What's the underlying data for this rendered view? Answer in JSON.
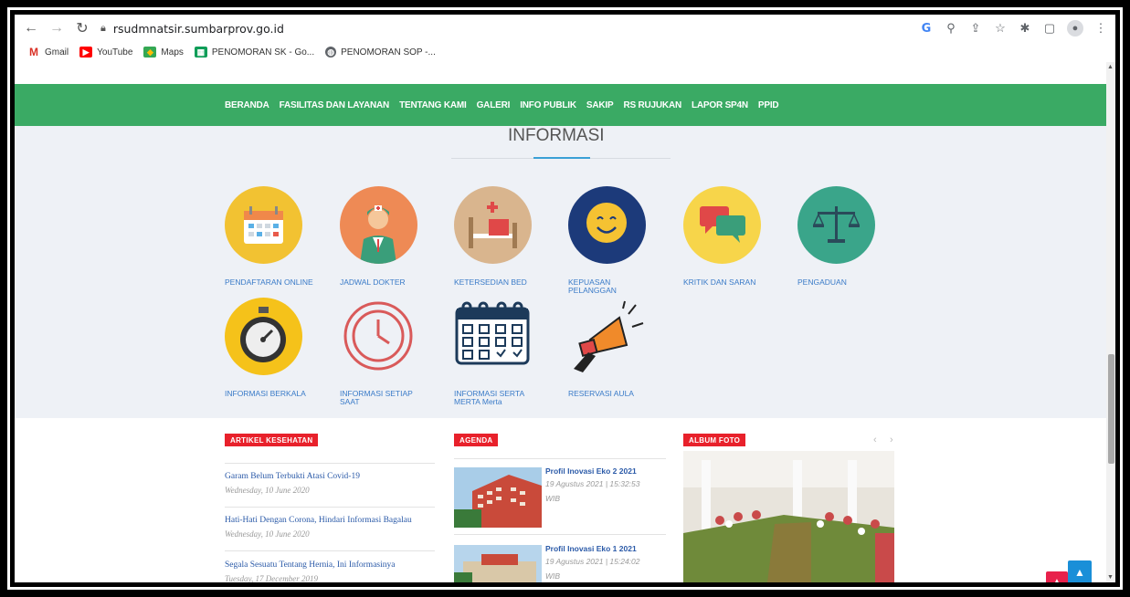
{
  "browser": {
    "url": "rsudmnatsir.sumbarprov.go.id",
    "bookmarks": [
      {
        "label": "Gmail",
        "icon": "gmail-icon",
        "color": "#d93025"
      },
      {
        "label": "YouTube",
        "icon": "youtube-icon",
        "color": "#ff0000"
      },
      {
        "label": "Maps",
        "icon": "maps-icon",
        "color": "#34a853"
      },
      {
        "label": "PENOMORAN SK - Go...",
        "icon": "sheets-icon",
        "color": "#0f9d58"
      },
      {
        "label": "PENOMORAN SOP -...",
        "icon": "globe-icon",
        "color": "#5f6368"
      }
    ],
    "tool_g": "G"
  },
  "navbar": {
    "items": [
      "BERANDA",
      "FASILITAS DAN LAYANAN",
      "TENTANG KAMI",
      "GALERI",
      "INFO PUBLIK",
      "SAKIP",
      "RS RUJUKAN",
      "LAPOR SP4N",
      "PPID"
    ],
    "color": "#3aaa64"
  },
  "info": {
    "title": "INFORMASI",
    "tiles": [
      {
        "label": "PENDAFTARAN ONLINE",
        "icon": "calendar-icon"
      },
      {
        "label": "JADWAL DOKTER",
        "icon": "doctor-icon"
      },
      {
        "label": "KETERSEDIAN BED",
        "icon": "hospital-bed-icon"
      },
      {
        "label": "KEPUASAN PELANGGAN",
        "icon": "smiley-icon"
      },
      {
        "label": "KRITIK DAN SARAN",
        "icon": "chat-bubbles-icon"
      },
      {
        "label": "PENGADUAN",
        "icon": "scales-icon"
      },
      {
        "label": "INFORMASI BERKALA",
        "icon": "stopwatch-icon"
      },
      {
        "label": "INFORMASI SETIAP SAAT",
        "icon": "clock-icon"
      },
      {
        "label": "INFORMASI SERTA MERTA Merta",
        "icon": "schedule-calendar-icon"
      },
      {
        "label": "RESERVASI AULA",
        "icon": "megaphone-icon"
      }
    ]
  },
  "artikel": {
    "tag": "ARTIKEL KESEHATAN",
    "items": [
      {
        "title": "Garam Belum Terbukti Atasi Covid-19",
        "date": "Wednesday, 10 June 2020"
      },
      {
        "title": "Hati-Hati Dengan Corona, Hindari Informasi Bagalau",
        "date": "Wednesday, 10 June 2020"
      },
      {
        "title": "Segala Sesuatu Tentang Hernia, Ini Informasinya",
        "date": "Tuesday, 17 December 2019"
      }
    ]
  },
  "agenda": {
    "tag": "AGENDA",
    "items": [
      {
        "title": "Profil Inovasi Eko 2 2021",
        "date": "19 Agustus 2021 | 15:32:53 WIB"
      },
      {
        "title": "Profil Inovasi Eko 1 2021",
        "date": "19 Agustus 2021 | 15:24:02 WIB"
      }
    ]
  },
  "album": {
    "tag": "ALBUM FOTO",
    "prev": "‹",
    "next": "›"
  },
  "buttons": {
    "scroll_top": "▲",
    "red": "▲"
  }
}
